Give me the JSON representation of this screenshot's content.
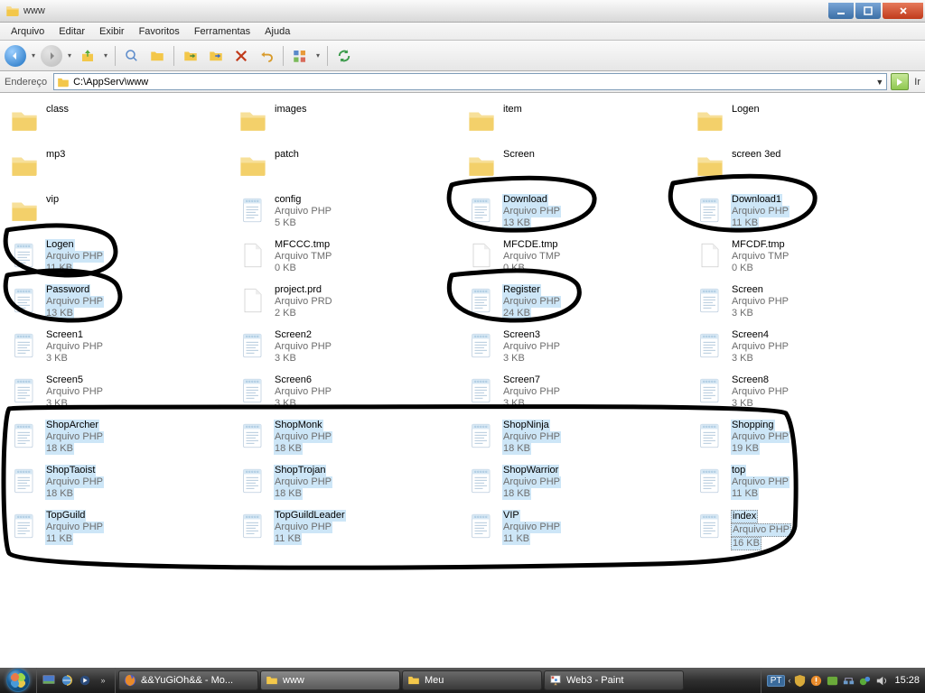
{
  "window": {
    "title": "www"
  },
  "menubar": [
    "Arquivo",
    "Editar",
    "Exibir",
    "Favoritos",
    "Ferramentas",
    "Ajuda"
  ],
  "address": {
    "label": "Endereço",
    "path": "C:\\AppServ\\www",
    "go_label": "Ir"
  },
  "files": [
    {
      "name": "class",
      "type": "",
      "size": "",
      "icon": "folder",
      "sel": false
    },
    {
      "name": "images",
      "type": "",
      "size": "",
      "icon": "folder",
      "sel": false
    },
    {
      "name": "item",
      "type": "",
      "size": "",
      "icon": "folder",
      "sel": false
    },
    {
      "name": "Logen",
      "type": "",
      "size": "",
      "icon": "folder",
      "sel": false
    },
    {
      "name": "mp3",
      "type": "",
      "size": "",
      "icon": "folder",
      "sel": false
    },
    {
      "name": "patch",
      "type": "",
      "size": "",
      "icon": "folder",
      "sel": false
    },
    {
      "name": "Screen",
      "type": "",
      "size": "",
      "icon": "folder",
      "sel": false
    },
    {
      "name": "screen 3ed",
      "type": "",
      "size": "",
      "icon": "folder",
      "sel": false
    },
    {
      "name": "vip",
      "type": "",
      "size": "",
      "icon": "folder",
      "sel": false
    },
    {
      "name": "config",
      "type": "Arquivo PHP",
      "size": "5 KB",
      "icon": "php",
      "sel": false
    },
    {
      "name": "Download",
      "type": "Arquivo PHP",
      "size": "13 KB",
      "icon": "php",
      "sel": true
    },
    {
      "name": "Download1",
      "type": "Arquivo PHP",
      "size": "11 KB",
      "icon": "php",
      "sel": true
    },
    {
      "name": "Logen",
      "type": "Arquivo PHP",
      "size": "11 KB",
      "icon": "php",
      "sel": true
    },
    {
      "name": "MFCCC.tmp",
      "type": "Arquivo TMP",
      "size": "0 KB",
      "icon": "blank",
      "sel": false
    },
    {
      "name": "MFCDE.tmp",
      "type": "Arquivo TMP",
      "size": "0 KB",
      "icon": "blank",
      "sel": false
    },
    {
      "name": "MFCDF.tmp",
      "type": "Arquivo TMP",
      "size": "0 KB",
      "icon": "blank",
      "sel": false
    },
    {
      "name": "Password",
      "type": "Arquivo PHP",
      "size": "13 KB",
      "icon": "php",
      "sel": true
    },
    {
      "name": "project.prd",
      "type": "Arquivo PRD",
      "size": "2 KB",
      "icon": "blank",
      "sel": false
    },
    {
      "name": "Register",
      "type": "Arquivo PHP",
      "size": "24 KB",
      "icon": "php",
      "sel": true
    },
    {
      "name": "Screen",
      "type": "Arquivo PHP",
      "size": "3 KB",
      "icon": "php",
      "sel": false
    },
    {
      "name": "Screen1",
      "type": "Arquivo PHP",
      "size": "3 KB",
      "icon": "php",
      "sel": false
    },
    {
      "name": "Screen2",
      "type": "Arquivo PHP",
      "size": "3 KB",
      "icon": "php",
      "sel": false
    },
    {
      "name": "Screen3",
      "type": "Arquivo PHP",
      "size": "3 KB",
      "icon": "php",
      "sel": false
    },
    {
      "name": "Screen4",
      "type": "Arquivo PHP",
      "size": "3 KB",
      "icon": "php",
      "sel": false
    },
    {
      "name": "Screen5",
      "type": "Arquivo PHP",
      "size": "3 KB",
      "icon": "php",
      "sel": false
    },
    {
      "name": "Screen6",
      "type": "Arquivo PHP",
      "size": "3 KB",
      "icon": "php",
      "sel": false
    },
    {
      "name": "Screen7",
      "type": "Arquivo PHP",
      "size": "3 KB",
      "icon": "php",
      "sel": false
    },
    {
      "name": "Screen8",
      "type": "Arquivo PHP",
      "size": "3 KB",
      "icon": "php",
      "sel": false
    },
    {
      "name": "ShopArcher",
      "type": "Arquivo PHP",
      "size": "18 KB",
      "icon": "php",
      "sel": true
    },
    {
      "name": "ShopMonk",
      "type": "Arquivo PHP",
      "size": "18 KB",
      "icon": "php",
      "sel": true
    },
    {
      "name": "ShopNinja",
      "type": "Arquivo PHP",
      "size": "18 KB",
      "icon": "php",
      "sel": true
    },
    {
      "name": "Shopping",
      "type": "Arquivo PHP",
      "size": "19 KB",
      "icon": "php",
      "sel": true
    },
    {
      "name": "ShopTaoist",
      "type": "Arquivo PHP",
      "size": "18 KB",
      "icon": "php",
      "sel": true
    },
    {
      "name": "ShopTrojan",
      "type": "Arquivo PHP",
      "size": "18 KB",
      "icon": "php",
      "sel": true
    },
    {
      "name": "ShopWarrior",
      "type": "Arquivo PHP",
      "size": "18 KB",
      "icon": "php",
      "sel": true
    },
    {
      "name": "top",
      "type": "Arquivo PHP",
      "size": "11 KB",
      "icon": "php",
      "sel": true
    },
    {
      "name": "TopGuild",
      "type": "Arquivo PHP",
      "size": "11 KB",
      "icon": "php",
      "sel": true
    },
    {
      "name": "TopGuildLeader",
      "type": "Arquivo PHP",
      "size": "11 KB",
      "icon": "php",
      "sel": true
    },
    {
      "name": "VIP",
      "type": "Arquivo PHP",
      "size": "11 KB",
      "icon": "php",
      "sel": true
    },
    {
      "name": "index",
      "type": "Arquivo PHP",
      "size": "16 KB",
      "icon": "php",
      "sel": true,
      "dotted": true
    }
  ],
  "taskbar": {
    "buttons": [
      {
        "label": "&&YuGiOh&& - Mo...",
        "icon": "firefox",
        "active": false
      },
      {
        "label": "www",
        "icon": "folder",
        "active": true
      },
      {
        "label": "Meu",
        "icon": "folder",
        "active": false
      },
      {
        "label": "Web3 - Paint",
        "icon": "paint",
        "active": false
      }
    ],
    "lang": "PT",
    "clock": "15:28"
  }
}
